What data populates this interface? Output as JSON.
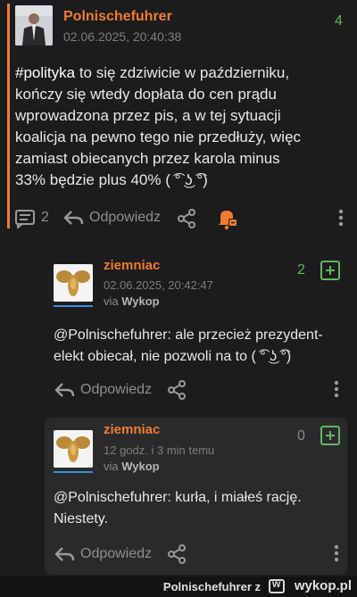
{
  "post": {
    "author": "Polnischefuhrer",
    "date": "02.06.2025, 20:40:38",
    "score": "4",
    "text_lines": [
      "#polityka to się zdziwicie w październiku,",
      "kończy się wtedy dopłata do cen prądu",
      "wprowadzona przez pis, a w tej sytuacji",
      "koalicja na pewno tego nie przedłuży, więc",
      "zamiast obiecanych przez karola minus",
      "33% będzie plus 40% ( ͡° ͜ʖ ͡°)"
    ],
    "comment_count": "2",
    "reply_label": "Odpowiedz",
    "icons": [
      "comments-icon",
      "reply-arrow-icon",
      "share-icon",
      "bell-notification-icon",
      "more-vertical-icon"
    ]
  },
  "replies": [
    {
      "author": "ziemniac",
      "date": "02.06.2025, 20:42:47",
      "via_prefix": "via",
      "via_app": "Wykop",
      "score": "2",
      "text_lines": [
        "@Polnischefuhrer: ale przecież prezydent-",
        "elekt obiecał, nie pozwoli na to ( ͡° ͜ʖ ͡°)"
      ],
      "reply_label": "Odpowiedz"
    },
    {
      "author": "ziemniac",
      "date": "12 godz. i 3 min temu",
      "via_prefix": "via",
      "via_app": "Wykop",
      "score": "0",
      "text_lines": [
        "@Polnischefuhrer: kurła, i miałeś rację.",
        "Niestety."
      ],
      "reply_label": "Odpowiedz"
    }
  ],
  "footer": {
    "username": "Polnischefuhrer",
    "separator": "z",
    "site": "wykop.pl"
  },
  "colors": {
    "accent": "#ef7d2e",
    "plus_green": "#5fb85a",
    "background": "#1c1c1e",
    "card": "#2a2a2d"
  }
}
